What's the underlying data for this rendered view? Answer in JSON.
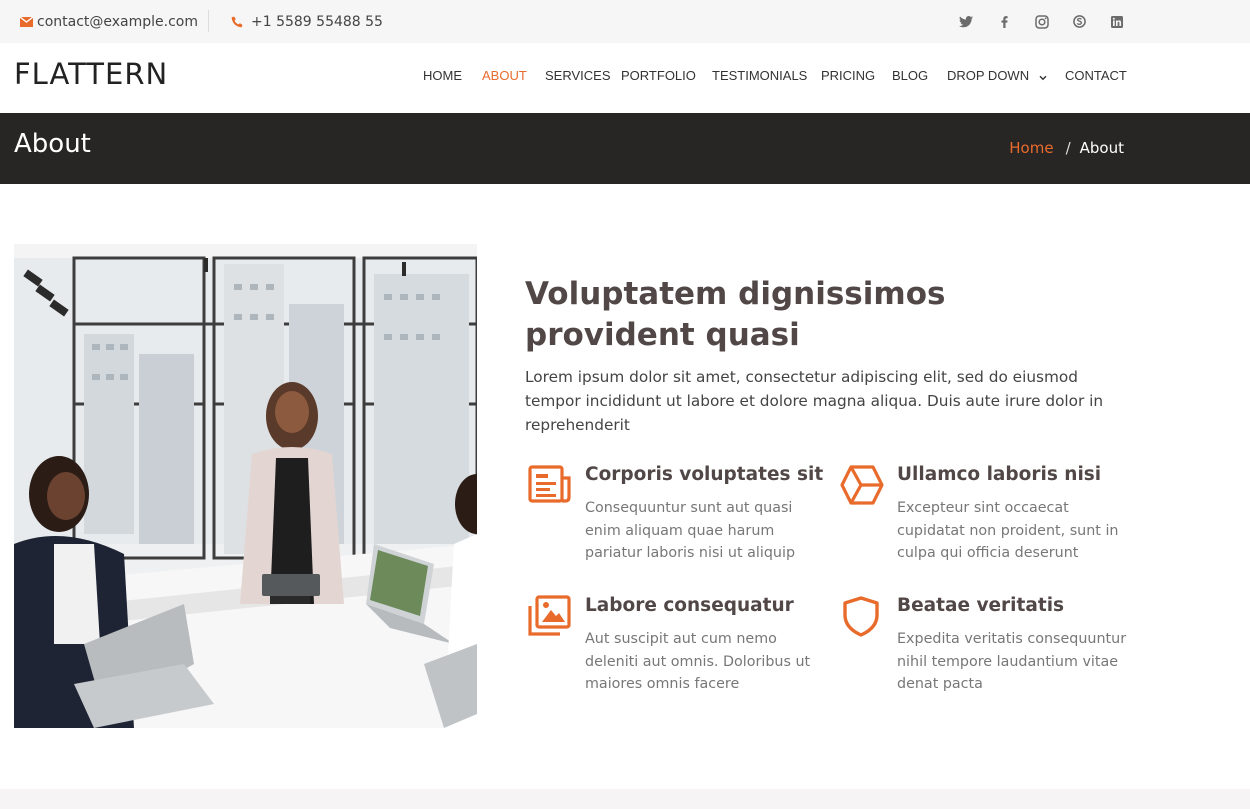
{
  "topbar": {
    "email": "contact@example.com",
    "phone": "+1 5589 55488 55",
    "social_icons": [
      "twitter-icon",
      "facebook-icon",
      "instagram-icon",
      "skype-icon",
      "linkedin-icon"
    ]
  },
  "header": {
    "logo": "FLATTERN",
    "nav": [
      {
        "label": "HOME"
      },
      {
        "label": "ABOUT",
        "active": true
      },
      {
        "label": "SERVICES"
      },
      {
        "label": "PORTFOLIO"
      },
      {
        "label": "TESTIMONIALS"
      },
      {
        "label": "PRICING"
      },
      {
        "label": "BLOG"
      },
      {
        "label": "DROP DOWN"
      },
      {
        "label": "CONTACT"
      }
    ]
  },
  "breadcrumb": {
    "page_title": "About",
    "home": "Home",
    "separator": "/",
    "current": "About"
  },
  "about": {
    "heading": "Voluptatem dignissimos provident quasi",
    "lead": "Lorem ipsum dolor sit amet, consectetur adipiscing elit, sed do eiusmod tempor incididunt ut labore et dolore magna aliqua. Duis aute irure dolor in reprehenderit",
    "features": [
      {
        "icon": "newspaper-icon",
        "title": "Corporis voluptates sit",
        "text": "Consequuntur sunt aut quasi enim aliquam quae harum pariatur laboris nisi ut aliquip"
      },
      {
        "icon": "cube-icon",
        "title": "Ullamco laboris nisi",
        "text": "Excepteur sint occaecat cupidatat non proident, sunt in culpa qui officia deserunt"
      },
      {
        "icon": "images-icon",
        "title": "Labore consequatur",
        "text": "Aut suscipit aut cum nemo deleniti aut omnis. Doloribus ut maiores omnis facere"
      },
      {
        "icon": "shield-icon",
        "title": "Beatae veritatis",
        "text": "Expedita veritatis consequuntur nihil tempore laudantium vitae denat pacta"
      }
    ]
  },
  "colors": {
    "accent": "#e96b2c",
    "band": "#282525",
    "heading": "#514747",
    "topbar_bg": "#f6f6f6"
  }
}
